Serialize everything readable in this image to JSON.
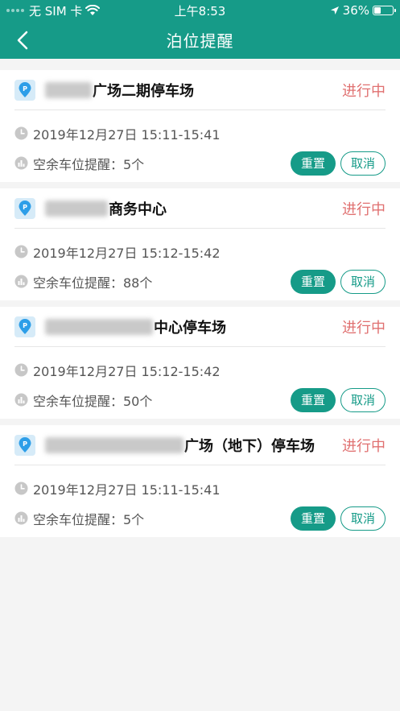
{
  "status_bar": {
    "carrier": "无 SIM 卡",
    "time": "上午8:53",
    "battery_level": "36%"
  },
  "header": {
    "title": "泊位提醒"
  },
  "reminders": [
    {
      "name_suffix": "广场二期停车场",
      "status": "进行中",
      "time": "2019年12月27日  15:11-15:41",
      "vacancy": "空余车位提醒：5个",
      "reset_label": "重置",
      "cancel_label": "取消"
    },
    {
      "name_suffix": "商务中心",
      "status": "进行中",
      "time": "2019年12月27日  15:12-15:42",
      "vacancy": "空余车位提醒：88个",
      "reset_label": "重置",
      "cancel_label": "取消"
    },
    {
      "name_suffix": "中心停车场",
      "status": "进行中",
      "time": "2019年12月27日  15:12-15:42",
      "vacancy": "空余车位提醒：50个",
      "reset_label": "重置",
      "cancel_label": "取消"
    },
    {
      "name_suffix": "广场（地下）停车场",
      "status": "进行中",
      "time": "2019年12月27日  15:11-15:41",
      "vacancy": "空余车位提醒：5个",
      "reset_label": "重置",
      "cancel_label": "取消"
    }
  ],
  "colors": {
    "accent": "#169b88",
    "status_text": "#e07070",
    "badge_bg": "#d6ebf8",
    "badge_icon": "#2d9ee8"
  },
  "icons": {
    "back": "chevron-left-icon",
    "parking": "parking-pin-icon",
    "clock": "clock-icon",
    "vacancy": "bar-chart-icon"
  }
}
